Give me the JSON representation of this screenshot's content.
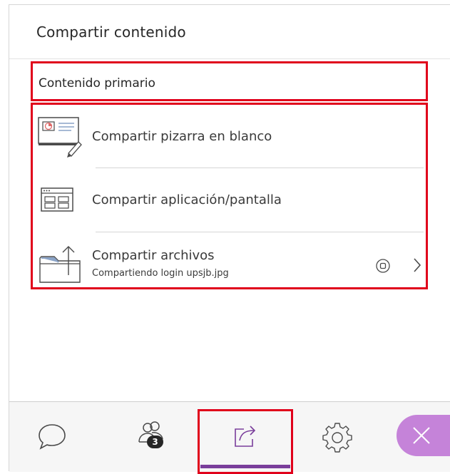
{
  "header": {
    "title": "Compartir contenido"
  },
  "section": {
    "title": "Contenido primario"
  },
  "items": [
    {
      "label": "Compartir pizarra en blanco",
      "icon": "whiteboard-icon"
    },
    {
      "label": "Compartir aplicación/pantalla",
      "icon": "application-window-icon"
    },
    {
      "label": "Compartir archivos",
      "sublabel": "Compartiendo login upsjb.jpg",
      "icon": "folder-icon"
    }
  ],
  "footer": {
    "buttons": [
      {
        "name": "chat",
        "icon": "chat-bubble-icon"
      },
      {
        "name": "attendees",
        "icon": "people-icon",
        "badge": "3"
      },
      {
        "name": "share-content",
        "icon": "share-arrow-icon",
        "active": true
      },
      {
        "name": "settings",
        "icon": "gear-icon"
      },
      {
        "name": "close",
        "icon": "close-icon"
      }
    ]
  },
  "colors": {
    "highlight_border": "#e0001b",
    "accent_purple": "#7a3e9b",
    "close_button_bg": "#c583d9",
    "icon_stroke": "#4a4a4a",
    "icon_blue": "#8aa3c7"
  }
}
